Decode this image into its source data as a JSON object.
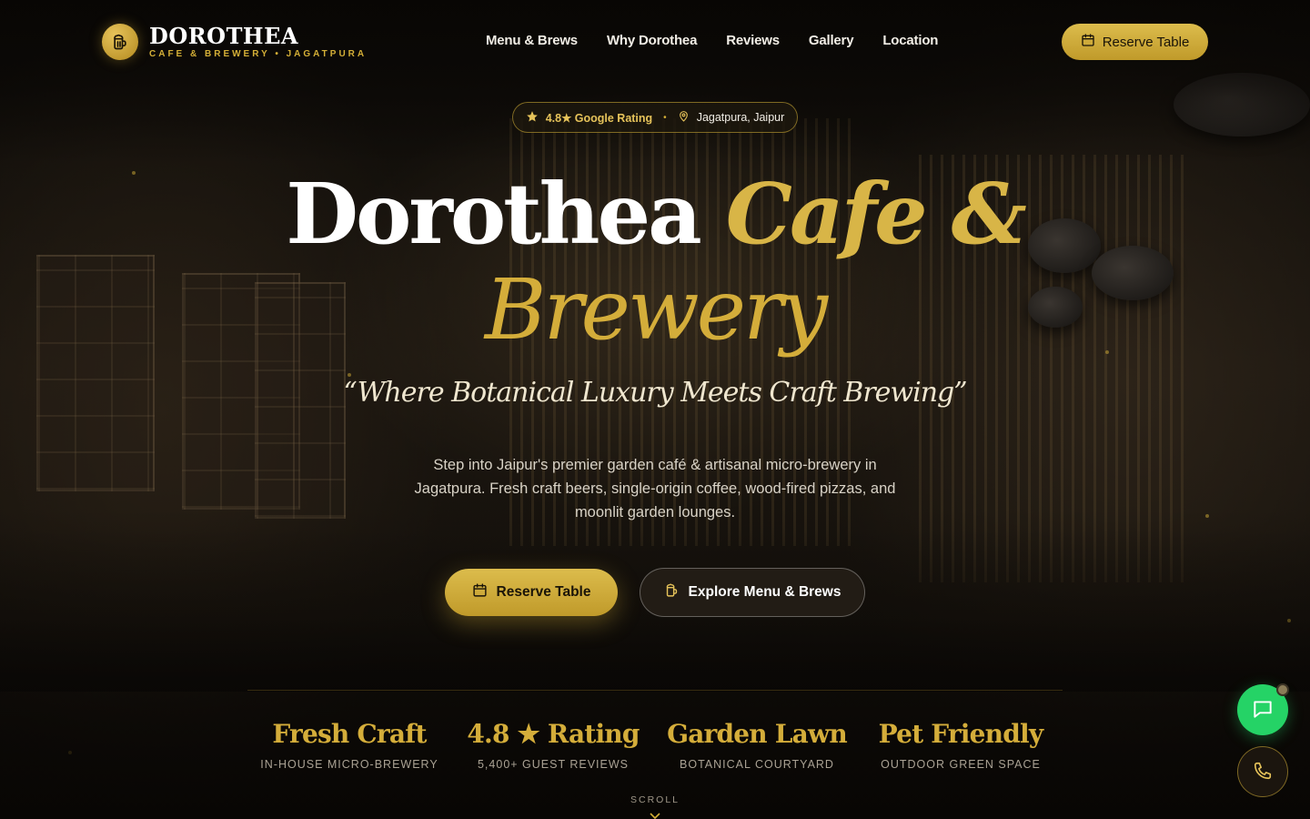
{
  "brand": {
    "name": "DOROTHEA",
    "tagline": "CAFE & BREWERY • JAGATPURA",
    "logo_icon": "beer-mug-icon"
  },
  "nav": {
    "items": [
      {
        "label": "Menu & Brews"
      },
      {
        "label": "Why Dorothea"
      },
      {
        "label": "Reviews"
      },
      {
        "label": "Gallery"
      },
      {
        "label": "Location"
      }
    ],
    "reserve_label": "Reserve Table"
  },
  "pill": {
    "rating": "4.8★ Google Rating",
    "separator": "•",
    "location": "Jagatpura, Jaipur"
  },
  "hero": {
    "title_plain": "Dorothea",
    "title_gold": "Cafe &",
    "title_line2": "Brewery",
    "tagline": "“Where Botanical Luxury Meets Craft Brewing”",
    "description": "Step into Jaipur's premier garden café & artisanal micro-brewery in Jagatpura. Fresh craft beers, single-origin coffee, wood-fired pizzas, and moonlit garden lounges.",
    "reserve_label": "Reserve Table",
    "explore_label": "Explore Menu & Brews"
  },
  "stats": [
    {
      "title": "Fresh Craft",
      "sub": "IN-HOUSE MICRO-BREWERY"
    },
    {
      "title": "4.8 ★ Rating",
      "sub": "5,400+ GUEST REVIEWS"
    },
    {
      "title": "Garden Lawn",
      "sub": "BOTANICAL COURTYARD"
    },
    {
      "title": "Pet Friendly",
      "sub": "OUTDOOR GREEN SPACE"
    }
  ],
  "scroll_label": "SCROLL",
  "colors": {
    "gold": "#d4af37",
    "chat_green": "#25d366",
    "background": "#15110c"
  },
  "icons": {
    "calendar": "calendar-icon",
    "star": "star-icon",
    "pin": "map-pin-icon",
    "mug": "beer-mug-icon",
    "chat": "chat-icon",
    "phone": "phone-icon",
    "chevron": "chevron-down-icon"
  }
}
